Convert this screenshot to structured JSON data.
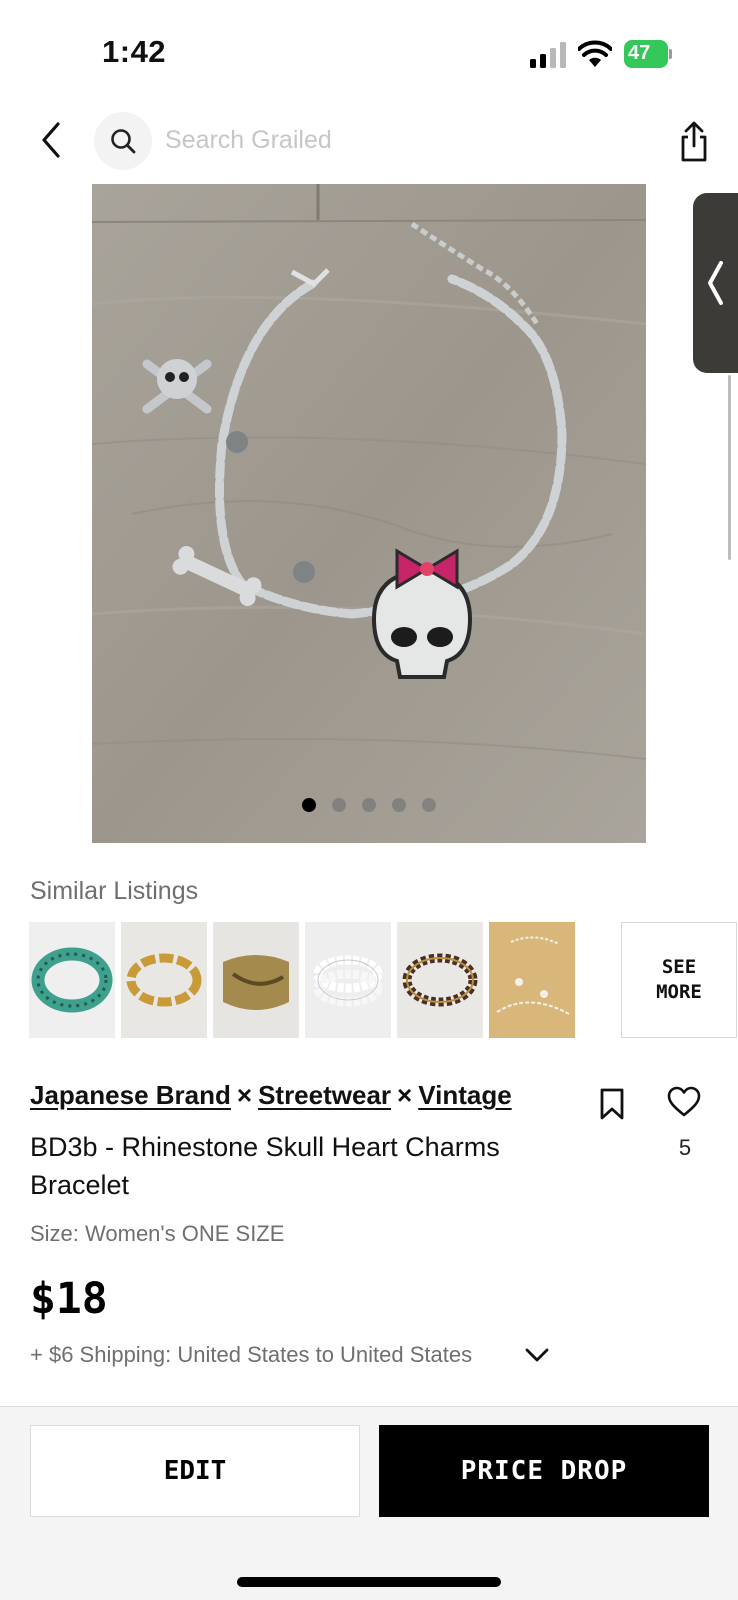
{
  "status_bar": {
    "time": "1:42",
    "battery_percent": "47"
  },
  "search": {
    "placeholder": "Search Grailed"
  },
  "gallery": {
    "image_count": 5,
    "active_index": 0
  },
  "similar_listings": {
    "title": "Similar Listings",
    "see_more_label": "SEE MORE"
  },
  "listing": {
    "designers": [
      "Japanese Brand",
      "Streetwear",
      "Vintage"
    ],
    "separator": "×",
    "title": "BD3b - Rhinestone Skull Heart Charms Bracelet",
    "size": "Size: Women's ONE SIZE",
    "price": "$18",
    "shipping": "+ $6 Shipping: United States to United States",
    "likes": "5"
  },
  "actions": {
    "edit_label": "EDIT",
    "price_drop_label": "PRICE DROP"
  },
  "colors": {
    "battery": "#34c759",
    "primary_button": "#000000"
  }
}
